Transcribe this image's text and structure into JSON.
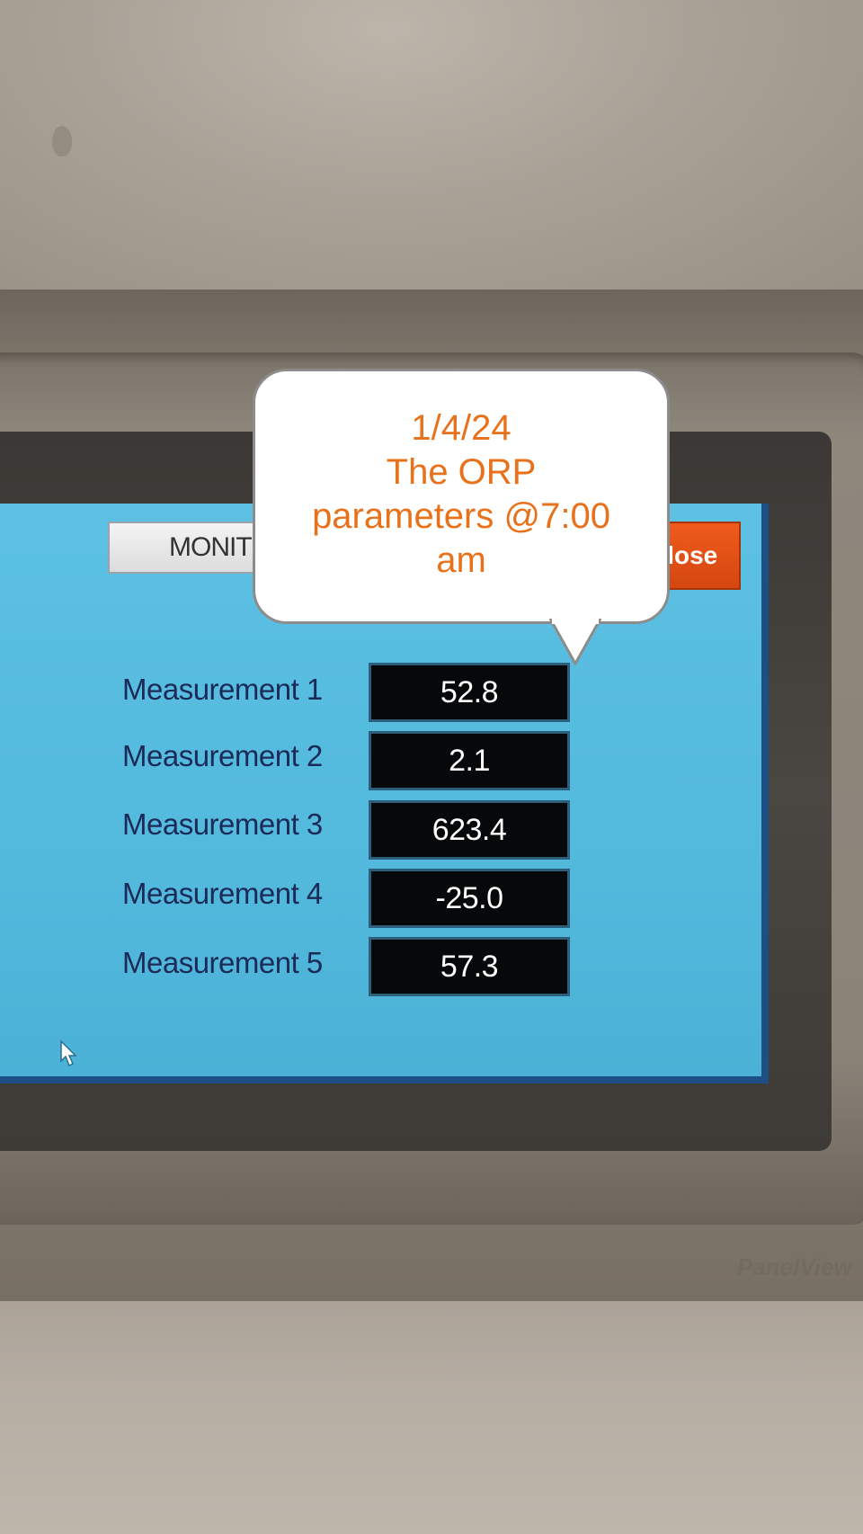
{
  "screen": {
    "monitor_button_label": "MONIT",
    "close_button_label": "Close",
    "measurements": [
      {
        "label": "Measurement 1",
        "value": "52.8"
      },
      {
        "label": "Measurement 2",
        "value": "2.1"
      },
      {
        "label": "Measurement 3",
        "value": "623.4"
      },
      {
        "label": "Measurement 4",
        "value": "-25.0"
      },
      {
        "label": "Measurement 5",
        "value": "57.3"
      }
    ]
  },
  "callout": {
    "line1": "1/4/24",
    "line2": "The ORP",
    "line3": "parameters @7:00",
    "line4": "am"
  },
  "device": {
    "bezel_logo": "PanelView"
  },
  "colors": {
    "screen_background": "#53b9dd",
    "close_button": "#e4531a",
    "callout_text": "#e8721c",
    "value_box": "#06080a"
  },
  "icons": {
    "pointer": "mouse-pointer-icon"
  }
}
